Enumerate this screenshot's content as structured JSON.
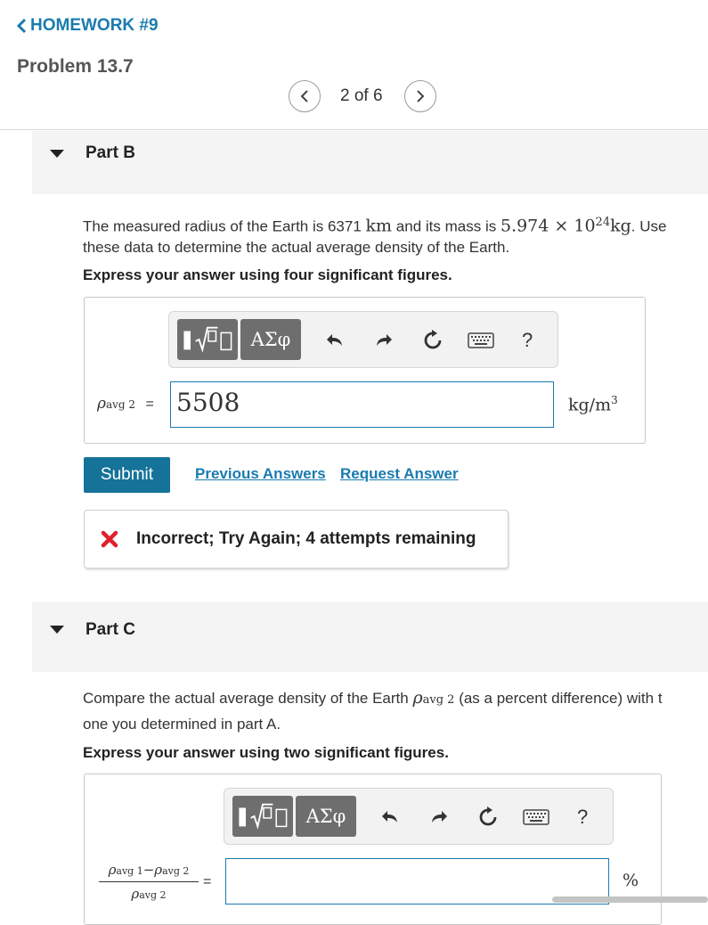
{
  "nav": {
    "back_label": "HOMEWORK #9"
  },
  "problem": {
    "title": "Problem 13.7"
  },
  "pager": {
    "text": "2 of 6"
  },
  "part_b": {
    "label": "Part B",
    "prompt_text_1": "The measured radius of the Earth is 6371",
    "prompt_unit_km": "km",
    "prompt_text_2": "and its mass is",
    "prompt_mass": "5.974 × 10",
    "prompt_mass_exp": "24",
    "prompt_mass_unit": "kg",
    "prompt_text_3": ". Use",
    "prompt_line_2": "these data to determine the actual average density of the Earth.",
    "instruction": "Express your answer using four significant figures.",
    "toolbar": {
      "greek_label": "ΑΣφ",
      "help_label": "?"
    },
    "var_symbol": "ρ",
    "var_subscript": "avg 2",
    "equals": "=",
    "answer_value": "5508",
    "unit": "kg/m",
    "unit_exp": "3",
    "submit_label": "Submit",
    "previous_answers_label": "Previous Answers",
    "request_answer_label": "Request Answer",
    "feedback": "Incorrect; Try Again; 4 attempts remaining"
  },
  "part_c": {
    "label": "Part C",
    "prompt_text_1": "Compare the actual average density of the Earth",
    "prompt_symbol": "ρ",
    "prompt_subscript": "avg 2",
    "prompt_text_2": "(as a percent difference) with t",
    "prompt_line_2": "one you determined in part A.",
    "instruction": "Express your answer using two significant figures.",
    "toolbar": {
      "greek_label": "ΑΣφ",
      "help_label": "?"
    },
    "numerator_symbol_1": "ρ",
    "numerator_sub_1": "avg 1",
    "minus": "−",
    "numerator_symbol_2": "ρ",
    "numerator_sub_2": "avg 2",
    "denominator_symbol": "ρ",
    "denominator_sub": "avg 2",
    "equals": "=",
    "answer_value": "",
    "unit": "%"
  },
  "colors": {
    "accent": "#1a7bb0",
    "submit": "#157399",
    "error": "#e0202b"
  }
}
